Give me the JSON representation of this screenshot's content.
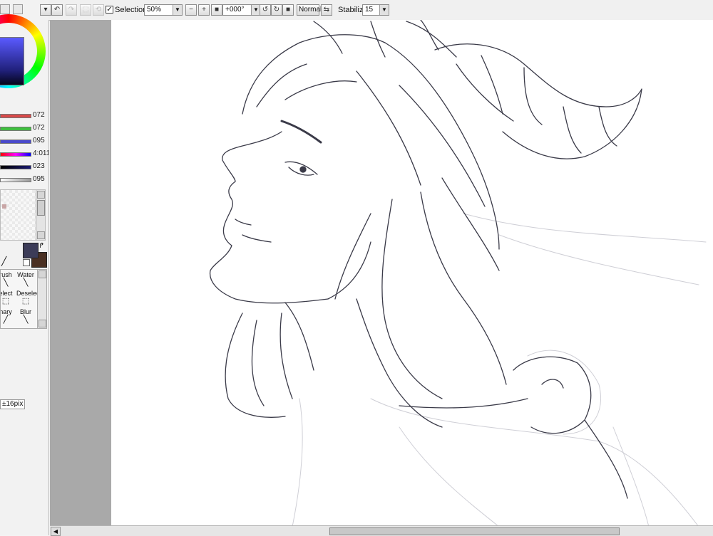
{
  "toolbar": {
    "selection_label": "Selection",
    "selection_checked": "✓",
    "zoom_value": "50%",
    "rotation_value": "+000°",
    "blend_mode": "Normal",
    "stabilizer_label": "Stabilizer",
    "stabilizer_value": "15"
  },
  "color_sliders": [
    {
      "value": "072",
      "color": "#d84a4a"
    },
    {
      "value": "072",
      "color": "#3fbf3f"
    },
    {
      "value": "095",
      "color": "#4a4acc"
    },
    {
      "value": "4:011",
      "color": "#8a3ad0"
    },
    {
      "value": "023",
      "color": "#1b1b70"
    },
    {
      "value": "095",
      "color": "#b7b7b7"
    }
  ],
  "colors": {
    "foreground": "#3c3c58",
    "background": "#4a3023"
  },
  "brushes": [
    {
      "label": "rush",
      "icon": "brush-icon"
    },
    {
      "label": "Water",
      "icon": "water-brush-icon"
    },
    {
      "label": "elect",
      "icon": "select-icon"
    },
    {
      "label": "Deselect",
      "icon": "deselect-icon"
    },
    {
      "label": "nary",
      "icon": "binary-icon"
    },
    {
      "label": "Blur",
      "icon": "blur-icon"
    }
  ],
  "brush_size_label": "±16pix"
}
